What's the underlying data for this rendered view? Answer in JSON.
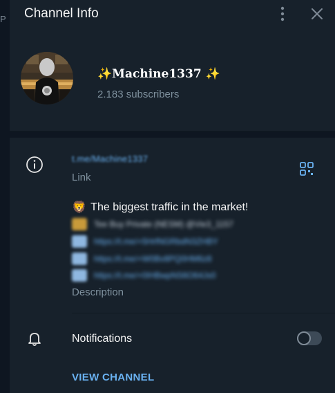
{
  "window": {
    "title": "Channel Info"
  },
  "backdrop": {
    "fragment": "P"
  },
  "profile": {
    "name": "✨Machine1337 ✨",
    "subscribers": "2.183 subscribers"
  },
  "link": {
    "value": "t.me/Machine1337",
    "label": "Link"
  },
  "description": {
    "line1_emoji": "🦁",
    "line1_text": "The biggest traffic in the market!",
    "blurred_lines": [
      "Tee Buy Private (NESM) @Vie3_1157",
      "https://t.me/+5HrfNGRbdN3ZHBY",
      "https://t.me/+W0Bv8PQ0HM6z8",
      "https://t.me/+0IHBwpNS6O64Js0"
    ],
    "label": "Description"
  },
  "notifications": {
    "label": "Notifications",
    "enabled": false
  },
  "view_button": {
    "label": "VIEW CHANNEL"
  },
  "icons": [
    "info-icon",
    "qr-code-icon",
    "bell-icon",
    "more-vertical-icon",
    "close-icon"
  ],
  "colors": {
    "background": "#17212b",
    "accent": "#6ab2f2",
    "secondary_text": "#7f919e",
    "divider": "#0e1621"
  }
}
